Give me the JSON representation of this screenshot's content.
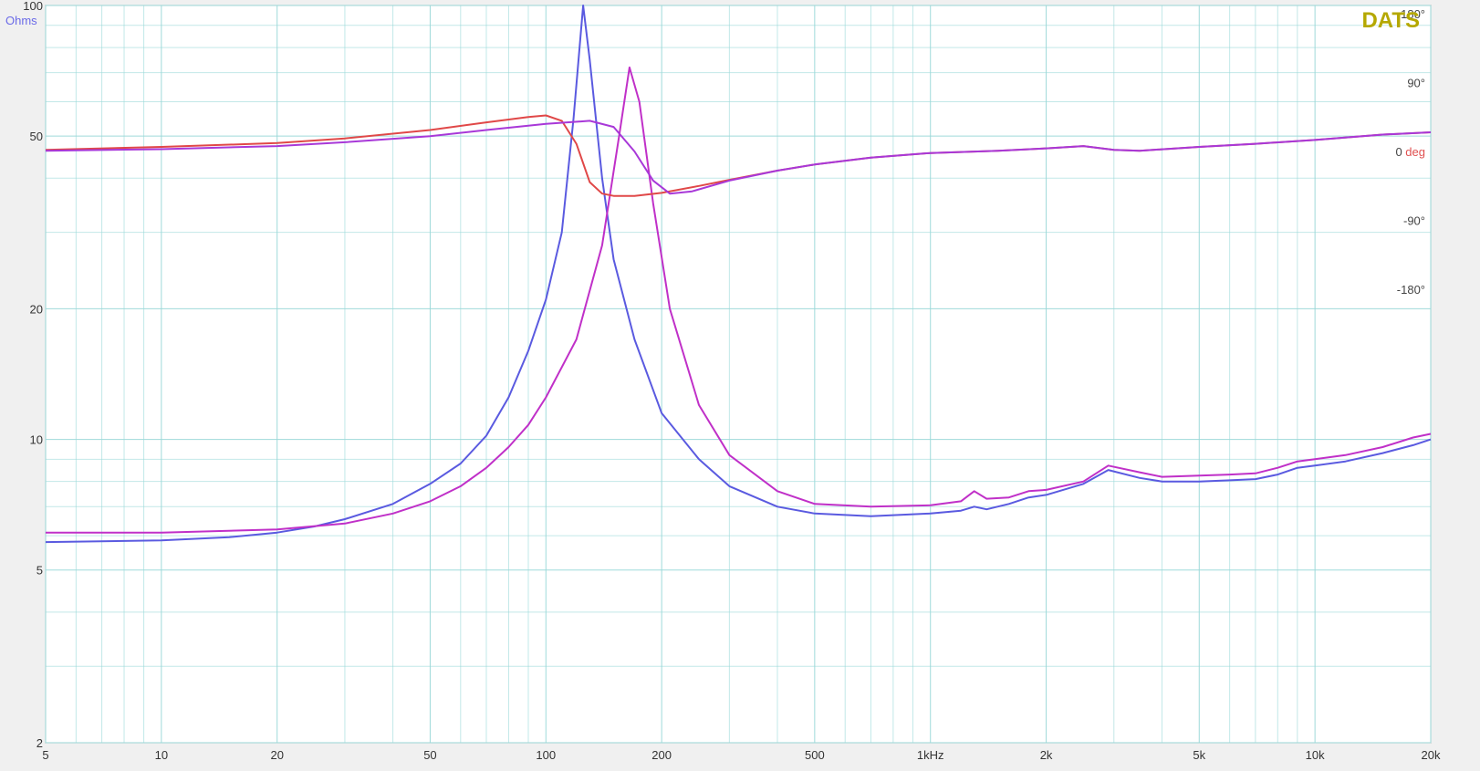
{
  "chart_data": {
    "type": "line",
    "brand": "DATS",
    "brand_color": "#b5a800",
    "left_unit": "Ohms",
    "left_unit_color": "#6a6ae8",
    "right_unit": "deg",
    "right_unit_color": "#e05050",
    "x_scale": "log",
    "xlim": [
      5,
      20000
    ],
    "x_ticks": [
      {
        "value": 5,
        "label": "5"
      },
      {
        "value": 10,
        "label": "10"
      },
      {
        "value": 20,
        "label": "20"
      },
      {
        "value": 50,
        "label": "50"
      },
      {
        "value": 100,
        "label": "100"
      },
      {
        "value": 200,
        "label": "200"
      },
      {
        "value": 500,
        "label": "500"
      },
      {
        "value": 1000,
        "label": "1kHz"
      },
      {
        "value": 2000,
        "label": "2k"
      },
      {
        "value": 5000,
        "label": "5k"
      },
      {
        "value": 10000,
        "label": "10k"
      },
      {
        "value": 20000,
        "label": "20k"
      }
    ],
    "y_scale": "log",
    "ylim": [
      2,
      100
    ],
    "y_ticks": [
      {
        "value": 100,
        "label": "100"
      },
      {
        "value": 50,
        "label": "50"
      },
      {
        "value": 20,
        "label": "20"
      },
      {
        "value": 10,
        "label": "10"
      },
      {
        "value": 5,
        "label": "5"
      },
      {
        "value": 2,
        "label": "2"
      }
    ],
    "phase_ticks": [
      {
        "value": 180,
        "label": "180°"
      },
      {
        "value": 90,
        "label": "90°"
      },
      {
        "value": 0,
        "label": "0"
      },
      {
        "value": -90,
        "label": "-90°"
      },
      {
        "value": -180,
        "label": "-180°"
      }
    ],
    "grid": true,
    "grid_color": "#9ad8d8",
    "series": [
      {
        "kind": "impedance",
        "color": "#5a5ae0",
        "points": [
          [
            5,
            5.8
          ],
          [
            10,
            5.85
          ],
          [
            15,
            5.95
          ],
          [
            20,
            6.1
          ],
          [
            25,
            6.3
          ],
          [
            30,
            6.55
          ],
          [
            40,
            7.1
          ],
          [
            50,
            7.9
          ],
          [
            60,
            8.8
          ],
          [
            70,
            10.2
          ],
          [
            80,
            12.5
          ],
          [
            90,
            16
          ],
          [
            100,
            21
          ],
          [
            110,
            30
          ],
          [
            118,
            55
          ],
          [
            125,
            100
          ],
          [
            130,
            75
          ],
          [
            140,
            40
          ],
          [
            150,
            26
          ],
          [
            170,
            17
          ],
          [
            200,
            11.5
          ],
          [
            250,
            9
          ],
          [
            300,
            7.8
          ],
          [
            400,
            7
          ],
          [
            500,
            6.75
          ],
          [
            700,
            6.65
          ],
          [
            1000,
            6.75
          ],
          [
            1200,
            6.85
          ],
          [
            1300,
            7.0
          ],
          [
            1400,
            6.9
          ],
          [
            1600,
            7.1
          ],
          [
            1800,
            7.35
          ],
          [
            2000,
            7.45
          ],
          [
            2500,
            7.9
          ],
          [
            2900,
            8.5
          ],
          [
            3500,
            8.15
          ],
          [
            4000,
            8.0
          ],
          [
            5000,
            8.0
          ],
          [
            6000,
            8.05
          ],
          [
            7000,
            8.1
          ],
          [
            8000,
            8.3
          ],
          [
            9000,
            8.6
          ],
          [
            10000,
            8.7
          ],
          [
            12000,
            8.9
          ],
          [
            15000,
            9.3
          ],
          [
            18000,
            9.7
          ],
          [
            20000,
            10.0
          ]
        ]
      },
      {
        "kind": "impedance",
        "color": "#c030c8",
        "points": [
          [
            5,
            6.1
          ],
          [
            10,
            6.1
          ],
          [
            20,
            6.2
          ],
          [
            30,
            6.4
          ],
          [
            40,
            6.75
          ],
          [
            50,
            7.2
          ],
          [
            60,
            7.8
          ],
          [
            70,
            8.6
          ],
          [
            80,
            9.6
          ],
          [
            90,
            10.8
          ],
          [
            100,
            12.5
          ],
          [
            120,
            17
          ],
          [
            140,
            28
          ],
          [
            155,
            50
          ],
          [
            165,
            72
          ],
          [
            175,
            60
          ],
          [
            190,
            35
          ],
          [
            210,
            20
          ],
          [
            250,
            12
          ],
          [
            300,
            9.2
          ],
          [
            400,
            7.6
          ],
          [
            500,
            7.1
          ],
          [
            700,
            7.0
          ],
          [
            1000,
            7.05
          ],
          [
            1200,
            7.2
          ],
          [
            1300,
            7.6
          ],
          [
            1400,
            7.3
          ],
          [
            1600,
            7.35
          ],
          [
            1800,
            7.6
          ],
          [
            2000,
            7.65
          ],
          [
            2500,
            8.0
          ],
          [
            2900,
            8.7
          ],
          [
            3500,
            8.4
          ],
          [
            4000,
            8.2
          ],
          [
            5000,
            8.25
          ],
          [
            6000,
            8.3
          ],
          [
            7000,
            8.35
          ],
          [
            8000,
            8.6
          ],
          [
            9000,
            8.9
          ],
          [
            10000,
            9.0
          ],
          [
            12000,
            9.2
          ],
          [
            15000,
            9.6
          ],
          [
            18000,
            10.1
          ],
          [
            20000,
            10.3
          ]
        ]
      },
      {
        "kind": "phase",
        "color": "#e04848",
        "points": [
          [
            5,
            2
          ],
          [
            10,
            6
          ],
          [
            20,
            11
          ],
          [
            30,
            17
          ],
          [
            50,
            28
          ],
          [
            70,
            38
          ],
          [
            90,
            45
          ],
          [
            100,
            47
          ],
          [
            110,
            40
          ],
          [
            120,
            10
          ],
          [
            130,
            -40
          ],
          [
            140,
            -55
          ],
          [
            150,
            -58
          ],
          [
            170,
            -58
          ],
          [
            200,
            -54
          ],
          [
            250,
            -45
          ],
          [
            300,
            -37
          ],
          [
            400,
            -25
          ],
          [
            500,
            -17
          ],
          [
            700,
            -8
          ],
          [
            1000,
            -2
          ],
          [
            1500,
            1
          ],
          [
            2000,
            4
          ],
          [
            2500,
            7
          ],
          [
            3000,
            2
          ],
          [
            3500,
            1
          ],
          [
            5000,
            6
          ],
          [
            7000,
            10
          ],
          [
            10000,
            15
          ],
          [
            15000,
            22
          ],
          [
            20000,
            25
          ]
        ]
      },
      {
        "kind": "phase",
        "color": "#a838d8",
        "points": [
          [
            5,
            1
          ],
          [
            10,
            3
          ],
          [
            20,
            7
          ],
          [
            30,
            12
          ],
          [
            50,
            20
          ],
          [
            70,
            28
          ],
          [
            100,
            36
          ],
          [
            130,
            40
          ],
          [
            150,
            32
          ],
          [
            170,
            0
          ],
          [
            190,
            -38
          ],
          [
            210,
            -55
          ],
          [
            240,
            -52
          ],
          [
            300,
            -38
          ],
          [
            400,
            -25
          ],
          [
            500,
            -17
          ],
          [
            700,
            -8
          ],
          [
            1000,
            -2
          ],
          [
            1500,
            1
          ],
          [
            2000,
            4
          ],
          [
            2500,
            7
          ],
          [
            3000,
            2
          ],
          [
            3500,
            1
          ],
          [
            5000,
            6
          ],
          [
            7000,
            10
          ],
          [
            10000,
            15
          ],
          [
            15000,
            22
          ],
          [
            20000,
            25
          ]
        ]
      }
    ]
  }
}
